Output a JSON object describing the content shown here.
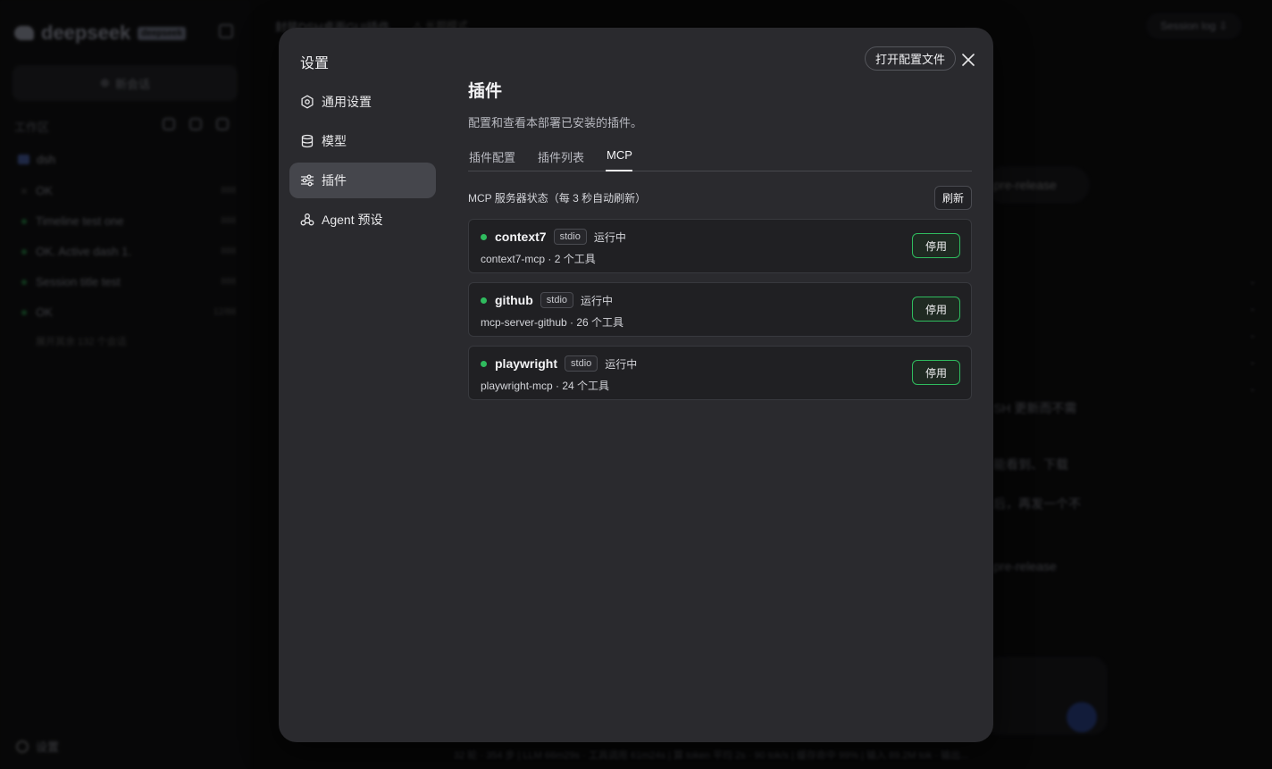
{
  "background": {
    "app": {
      "logo_text": "deepseek",
      "logo_badge": "deepseek",
      "new_chat_label": "新会话",
      "workspace_label": "工作区",
      "folder_name": "dsh",
      "sessions": [
        {
          "title": "OK",
          "count": "888",
          "dot": "off"
        },
        {
          "title": "Timeline test one",
          "count": "888",
          "dot": "on"
        },
        {
          "title": "OK. Active dash 1.",
          "count": "888",
          "dot": "on"
        },
        {
          "title": "Session title test",
          "count": "888",
          "dot": "on"
        },
        {
          "title": "OK",
          "count": "12/88",
          "dot": "on"
        }
      ],
      "more_sessions": "展开其余 132 个会话",
      "settings_label": "设置",
      "title": "封装DSH桌面GUI插件",
      "title_mode": "⚠ 长期模式",
      "session_log": "Session log ⇩",
      "pill_text": "pre-release",
      "snippets": [
        "SH 更新而不需",
        "能看到、下载",
        "后，再发一个不",
        "pre-release"
      ],
      "status_bar": "32 轮 · 354 步  |  LLM 66m29s · 工具调用 61m24s  |  算 token 平均 2s · 90 tok/s  |  缓存命中 99%  |  输入 89.2M tok · 输出..."
    }
  },
  "modal": {
    "title": "设置",
    "open_config_label": "打开配置文件",
    "nav": [
      {
        "label": "通用设置",
        "icon": "gear-icon"
      },
      {
        "label": "模型",
        "icon": "database-icon"
      },
      {
        "label": "插件",
        "icon": "sliders-icon"
      },
      {
        "label": "Agent 预设",
        "icon": "agent-icon"
      }
    ],
    "active_nav": "插件",
    "section": {
      "title": "插件",
      "description": "配置和查看本部署已安装的插件。",
      "tabs": [
        "插件配置",
        "插件列表",
        "MCP"
      ],
      "active_tab": "MCP",
      "status_label": "MCP 服务器状态（每 3 秒自动刷新）",
      "refresh_label": "刷新",
      "servers": [
        {
          "name": "context7",
          "transport": "stdio",
          "state": "运行中",
          "meta": "context7-mcp · 2 个工具",
          "action": "停用"
        },
        {
          "name": "github",
          "transport": "stdio",
          "state": "运行中",
          "meta": "mcp-server-github · 26 个工具",
          "action": "停用"
        },
        {
          "name": "playwright",
          "transport": "stdio",
          "state": "运行中",
          "meta": "playwright-mcp · 24 个工具",
          "action": "停用"
        }
      ]
    }
  },
  "colors": {
    "accent_green": "#2fbb5e",
    "modal_bg": "#2a2a2e",
    "active_nav_bg": "#45464c"
  }
}
